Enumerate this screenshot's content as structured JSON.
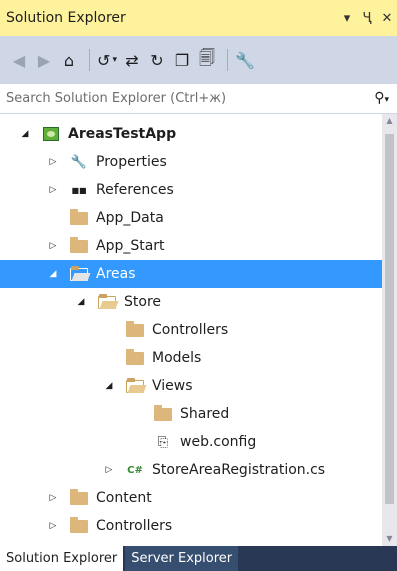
{
  "title": "Solution Explorer",
  "title_controls": {
    "dropdown": "▾",
    "pin": "ᵖ",
    "close": "✕"
  },
  "toolbar": {
    "back": "◀",
    "forward": "▶",
    "home": "⌂",
    "history": "↺",
    "caret": "▾",
    "sync": "⇄",
    "refresh": "↻",
    "collapse": "❐",
    "show_all": "🗐",
    "properties": "🔧"
  },
  "search": {
    "placeholder": "Search Solution Explorer (Ctrl+ж)",
    "icon": "⚲",
    "caret": "▾"
  },
  "tree": [
    {
      "label": "AreasTestApp",
      "bold": true,
      "expander": "◢",
      "icon": "project-icon"
    },
    {
      "label": "Properties",
      "expander": "▷",
      "icon": "wrench-icon",
      "glyph": "🔧"
    },
    {
      "label": "References",
      "expander": "▷",
      "icon": "references-icon",
      "glyph": "■■"
    },
    {
      "label": "App_Data",
      "expander": "",
      "icon": "folder-icon"
    },
    {
      "label": "App_Start",
      "expander": "▷",
      "icon": "folder-icon"
    },
    {
      "label": "Areas",
      "expander": "◢",
      "icon": "folder-open-icon",
      "selected": true
    },
    {
      "label": "Store",
      "expander": "◢",
      "icon": "folder-open-icon"
    },
    {
      "label": "Controllers",
      "expander": "",
      "icon": "folder-icon"
    },
    {
      "label": "Models",
      "expander": "",
      "icon": "folder-icon"
    },
    {
      "label": "Views",
      "expander": "◢",
      "icon": "folder-open-icon"
    },
    {
      "label": "Shared",
      "expander": "",
      "icon": "folder-icon"
    },
    {
      "label": "web.config",
      "expander": "",
      "icon": "config-icon",
      "glyph": "⎘"
    },
    {
      "label": "StoreAreaRegistration.cs",
      "expander": "▷",
      "icon": "csharp-icon",
      "glyph": "C#"
    },
    {
      "label": "Content",
      "expander": "▷",
      "icon": "folder-icon"
    },
    {
      "label": "Controllers",
      "expander": "▷",
      "icon": "folder-icon"
    }
  ],
  "tabs": {
    "active": "Solution Explorer",
    "inactive": "Server Explorer"
  },
  "colors": {
    "titlebar": "#fff29d",
    "toolbar": "#cfd6e5",
    "selection": "#3399ff",
    "tabstrip": "#293955",
    "folder": "#dcb67a"
  }
}
